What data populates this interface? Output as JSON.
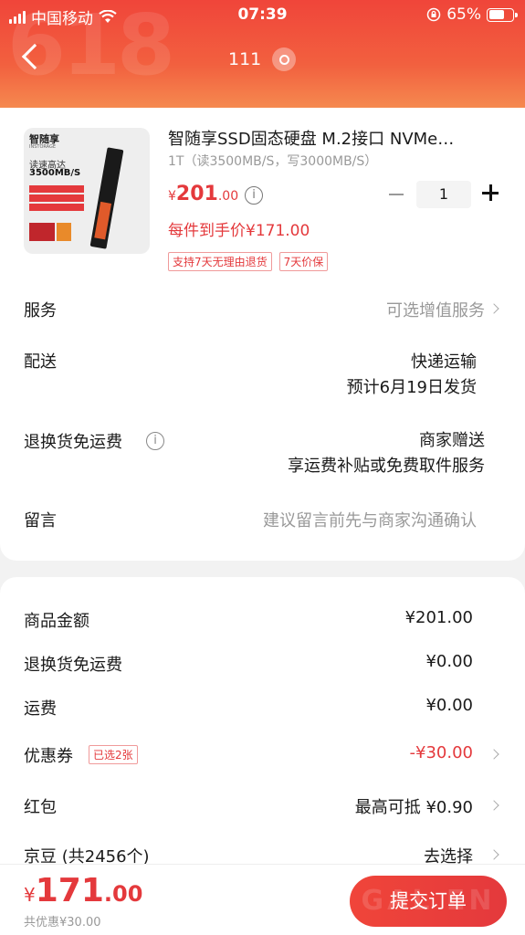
{
  "status_bar": {
    "carrier": "中国移动",
    "time": "07:39",
    "battery": "65%",
    "battery_level": 0.65
  },
  "header": {
    "watermark": "618",
    "title": "111"
  },
  "product": {
    "title": "智随享SSD固态硬盘 M.2接口 NVMe…",
    "spec": "1T（读3500MB/S，写3000MB/S）",
    "price_currency": "¥",
    "price_int": "201",
    "price_dec": ".00",
    "quantity": "1",
    "unit_price": "每件到手价¥171.00",
    "badges": [
      "支持7天无理由退货",
      "7天价保"
    ],
    "image": {
      "brand": "智随享",
      "brand_sub": "INSTORAGE",
      "line1": "读速高达",
      "line2": "3500MB/S"
    }
  },
  "rows": {
    "service": {
      "label": "服务",
      "value": "可选增值服务"
    },
    "delivery": {
      "label": "配送",
      "value": "快递运输",
      "sub": "预计6月19日发货"
    },
    "return_shipping": {
      "label": "退换货免运费",
      "value": "商家赠送",
      "sub": "享运费补贴或免费取件服务"
    },
    "message": {
      "label": "留言",
      "placeholder": "建议留言前先与商家沟通确认"
    }
  },
  "summary": {
    "goods_amount": {
      "label": "商品金额",
      "value": "¥201.00"
    },
    "return_fee": {
      "label": "退换货免运费",
      "value": "¥0.00"
    },
    "shipping": {
      "label": "运费",
      "value": "¥0.00"
    },
    "coupon": {
      "label": "优惠券",
      "tag": "已选2张",
      "value": "-¥30.00"
    },
    "red_packet": {
      "label": "红包",
      "value": "最高可抵 ¥0.90"
    },
    "jingdou": {
      "label": "京豆 (共2456个)",
      "value": "去选择"
    }
  },
  "footer": {
    "total_currency": "¥",
    "total_int": "171",
    "total_dec": ".00",
    "saved": "共优惠¥30.00",
    "submit": "提交订单",
    "submit_watermark": "GAL EN"
  },
  "colors": {
    "accent": "#e4393c",
    "header_top": "#f0453a",
    "header_bottom": "#f5894f"
  }
}
